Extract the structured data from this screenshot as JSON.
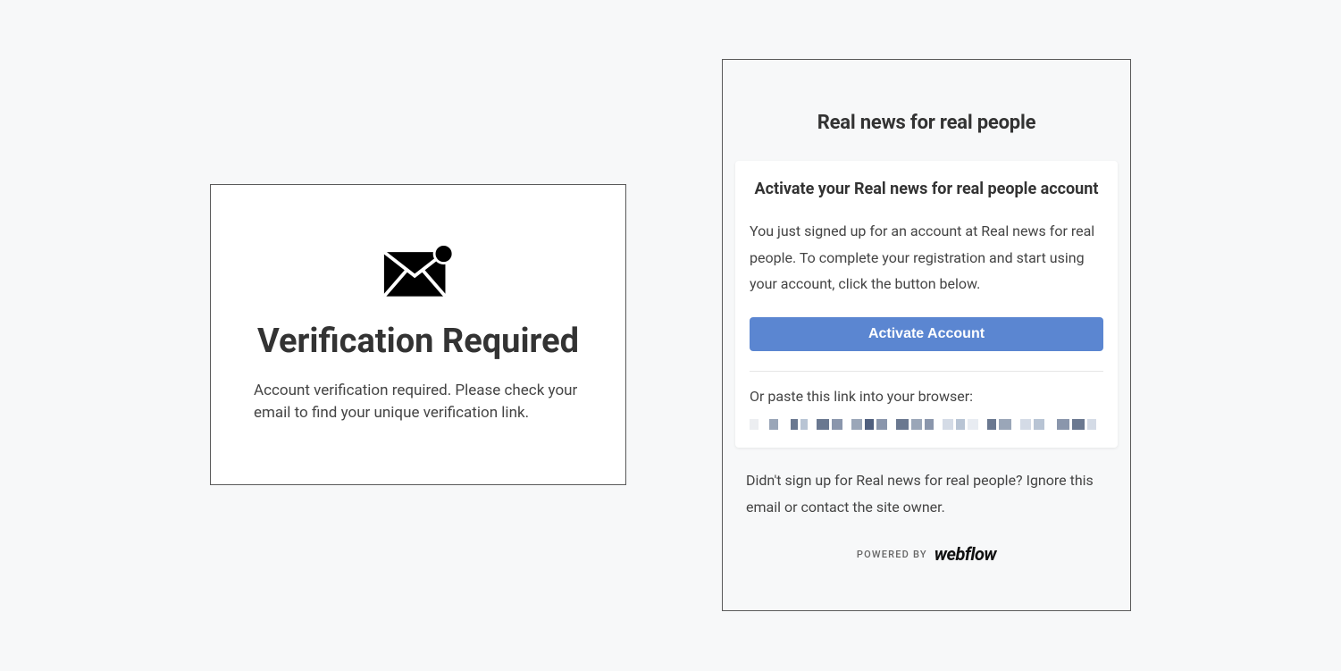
{
  "left": {
    "title": "Verification Required",
    "body": "Account verification required. Please check your email to find your unique verification link."
  },
  "right": {
    "brand_title": "Real news for real people",
    "card": {
      "title": "Activate your Real news for real people account",
      "body": "You just signed up for an account at Real news for real people. To complete your registration and start using your account, click the button below.",
      "button_label": "Activate Account",
      "paste_label": "Or paste this link into your browser:"
    },
    "footer_note": "Didn't sign up for Real news for real people? Ignore this email or contact the site owner.",
    "powered_by_label": "POWERED BY",
    "powered_by_brand": "webflow"
  },
  "colors": {
    "accent": "#5b86d1"
  }
}
